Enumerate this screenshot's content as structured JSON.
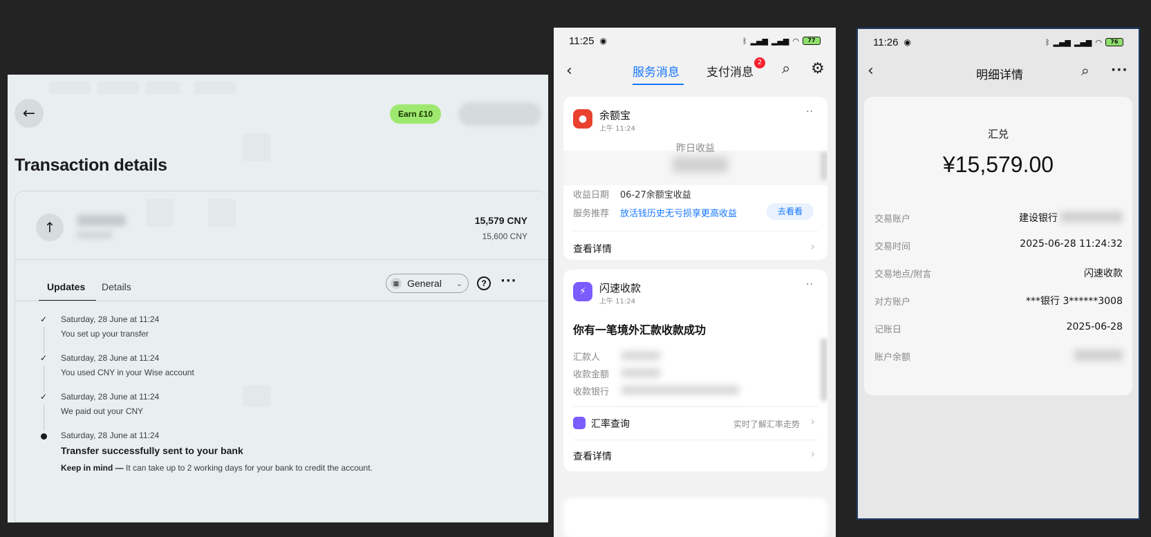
{
  "wise": {
    "earn_label": "Earn £10",
    "title": "Transaction details",
    "amount_primary": "15,579 CNY",
    "amount_secondary": "15,600 CNY",
    "tabs": [
      "Updates",
      "Details"
    ],
    "filter_label": "General",
    "timeline": [
      {
        "date": "Saturday, 28 June at 11:24",
        "text": "You set up your transfer",
        "status": "done"
      },
      {
        "date": "Saturday, 28 June at 11:24",
        "text": "You used CNY in your Wise account",
        "status": "done"
      },
      {
        "date": "Saturday, 28 June at 11:24",
        "text": "We paid out your CNY",
        "status": "done"
      },
      {
        "date": "Saturday, 28 June at 11:24",
        "text": "Transfer successfully sent to your bank",
        "status": "current",
        "note_bold": "Keep in mind —",
        "note": " It can take up to 2 working days for your bank to credit the account."
      }
    ]
  },
  "alipay": {
    "status_time": "11:25",
    "battery": "77",
    "tab_service": "服务消息",
    "tab_payment": "支付消息",
    "payment_badge": "2",
    "card1": {
      "app": "余额宝",
      "time": "上午 11:24",
      "headline": "昨日收益",
      "date_label": "收益日期",
      "date_value": "06-27余额宝收益",
      "rec_label": "服务推荐",
      "rec_value": "放活钱历史无亏损享更高收益",
      "rec_button": "去看看",
      "detail_link": "查看详情"
    },
    "card2": {
      "app": "闪速收款",
      "time": "上午 11:24",
      "headline": "你有一笔境外汇款收款成功",
      "rows": [
        "汇款人",
        "收款金额",
        "收款银行"
      ],
      "rate_label": "汇率查询",
      "rate_side": "实时了解汇率走势",
      "detail_link": "查看详情"
    }
  },
  "ccb": {
    "status_time": "11:26",
    "battery": "76",
    "title": "明细详情",
    "type": "汇兑",
    "amount": "¥15,579.00",
    "rows": [
      {
        "label": "交易账户",
        "value": "建设银行"
      },
      {
        "label": "交易时间",
        "value": "2025-06-28 11:24:32"
      },
      {
        "label": "交易地点/附言",
        "value": "闪速收款"
      },
      {
        "label": "对方账户",
        "value": "***银行 3******3008"
      },
      {
        "label": "记账日",
        "value": "2025-06-28"
      },
      {
        "label": "账户余额",
        "value": ""
      }
    ]
  }
}
